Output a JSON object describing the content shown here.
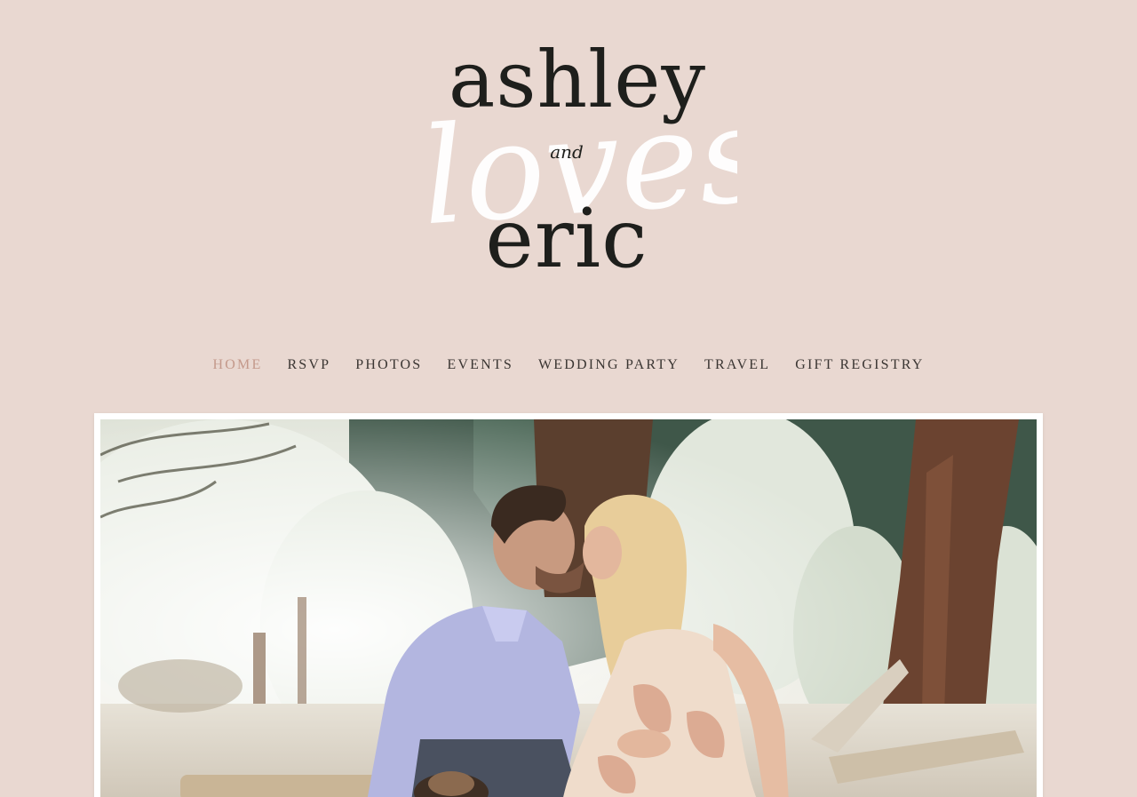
{
  "logo": {
    "name_one": "ashley",
    "connector": "and",
    "script_word": "loves",
    "name_two": "eric"
  },
  "nav": {
    "items": [
      {
        "label": "HOME",
        "active": true
      },
      {
        "label": "RSVP",
        "active": false
      },
      {
        "label": "PHOTOS",
        "active": false
      },
      {
        "label": "EVENTS",
        "active": false
      },
      {
        "label": "WEDDING PARTY",
        "active": false
      },
      {
        "label": "TRAVEL",
        "active": false
      },
      {
        "label": "GIFT REGISTRY",
        "active": false
      }
    ]
  },
  "colors": {
    "background": "#e9d8d1",
    "text": "#1e1f1c",
    "accent": "#c4998b",
    "frame": "#ffffff"
  },
  "hero": {
    "image": "engagement-photo-couple-kissing-in-forest"
  }
}
